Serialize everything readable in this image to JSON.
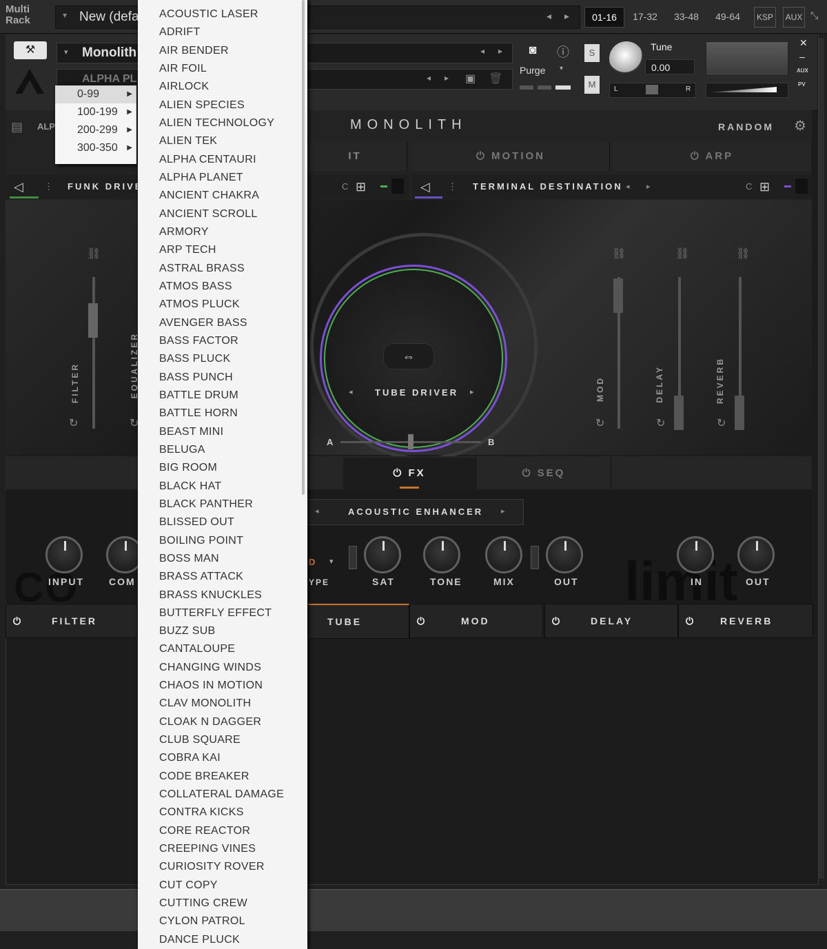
{
  "rack": {
    "label_line1": "Multi",
    "label_line2": "Rack",
    "preset": "New (defa",
    "pages": [
      "01-16",
      "17-32",
      "33-48",
      "49-64"
    ],
    "ksp": "KSP",
    "aux": "AUX"
  },
  "instrument": {
    "name": "Monolith",
    "snapshot": "ALPHA PL",
    "purge_label": "Purge",
    "tune_label": "Tune",
    "tune_value": "0.00",
    "solo": "S",
    "mute": "M",
    "pan_left": "L",
    "pan_right": "R",
    "aux_small": "AUX",
    "pv_small": "PV",
    "header_snapshot": "ALP"
  },
  "monolith": {
    "title": "MONOLITH",
    "random_label": "RANDOM",
    "tabs": [
      "IT",
      "MOTION",
      "ARP"
    ],
    "layer_left": "FUNK DRIVE",
    "layer_right": "TERMINAL DESTINATION",
    "c_label": "C",
    "left_sliders": [
      "FILTER",
      "EQUALIZER"
    ],
    "right_sliders": [
      "MOD",
      "DELAY",
      "REVERB"
    ],
    "center_preset": "TUBE DRIVER",
    "ab_a": "A",
    "ab_b": "B",
    "lower_tabs": [
      "FX",
      "SEQ"
    ],
    "fx_preset": "ACOUSTIC ENHANCER",
    "knobs": [
      "INPUT",
      "COM",
      "SAT",
      "TONE",
      "MIX",
      "OUT",
      "IN",
      "OUT"
    ],
    "type_label": "YPE",
    "type_prefix": "D",
    "limit_bg": "limit",
    "comp_bg": "CO",
    "fx_chain": [
      "FILTER",
      "TUBE",
      "MOD",
      "DELAY",
      "REVERB"
    ]
  },
  "range_menu": {
    "items": [
      "0-99",
      "100-199",
      "200-299",
      "300-350"
    ],
    "selected": "0-99"
  },
  "preset_menu": {
    "items": [
      "ACOUSTIC LASER",
      "ADRIFT",
      "AIR BENDER",
      "AIR FOIL",
      "AIRLOCK",
      "ALIEN SPECIES",
      "ALIEN TECHNOLOGY",
      "ALIEN TEK",
      "ALPHA CENTAURI",
      "ALPHA PLANET",
      "ANCIENT CHAKRA",
      "ANCIENT SCROLL",
      "ARMORY",
      "ARP TECH",
      "ASTRAL BRASS",
      "ATMOS BASS",
      "ATMOS PLUCK",
      "AVENGER BASS",
      "BASS FACTOR",
      "BASS PLUCK",
      "BASS PUNCH",
      "BATTLE DRUM",
      "BATTLE HORN",
      "BEAST MINI",
      "BELUGA",
      "BIG ROOM",
      "BLACK HAT",
      "BLACK PANTHER",
      "BLISSED OUT",
      "BOILING POINT",
      "BOSS MAN",
      "BRASS ATTACK",
      "BRASS KNUCKLES",
      "BUTTERFLY EFFECT",
      "BUZZ SUB",
      "CANTALOUPE",
      "CHANGING WINDS",
      "CHAOS IN MOTION",
      "CLAV MONOLITH",
      "CLOAK N DAGGER",
      "CLUB SQUARE",
      "COBRA KAI",
      "CODE BREAKER",
      "COLLATERAL DAMAGE",
      "CONTRA KICKS",
      "CORE REACTOR",
      "CREEPING VINES",
      "CURIOSITY ROVER",
      "CUT COPY",
      "CUTTING CREW",
      "CYLON PATROL",
      "DANCE PLUCK"
    ]
  },
  "colors": {
    "accent_orange": "#c9742e",
    "ring_green": "#4caf50",
    "ring_purple": "#7b4fd6"
  }
}
